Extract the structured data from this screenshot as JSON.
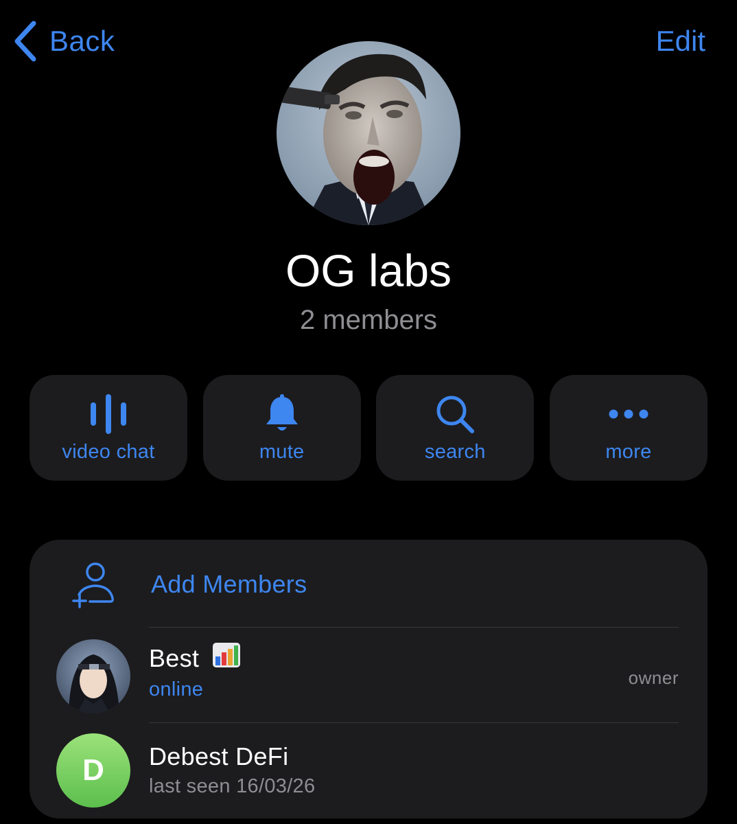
{
  "nav": {
    "back_label": "Back",
    "edit_label": "Edit",
    "accent_color": "#3e86f0"
  },
  "group": {
    "title": "OG labs",
    "subtitle": "2 members",
    "avatar": "group-photo-man-screaming"
  },
  "actions": [
    {
      "label": "video chat",
      "icon": "voice-wave-icon"
    },
    {
      "label": "mute",
      "icon": "bell-icon"
    },
    {
      "label": "search",
      "icon": "magnifier-icon"
    },
    {
      "label": "more",
      "icon": "ellipsis-icon"
    }
  ],
  "members_section": {
    "add_label": "Add Members",
    "add_icon": "add-person-icon",
    "members": [
      {
        "name": "Best",
        "emoji": "bar-chart-emoji",
        "status": "online",
        "status_color": "#3e86f0",
        "role": "owner",
        "avatar": "anime-character-avatar"
      },
      {
        "name": "Debest DeFi",
        "status": "last seen 16/03/26",
        "status_color": "#8e8e93",
        "role": "",
        "avatar_letter": "D",
        "avatar_color": "#7ed267"
      }
    ]
  }
}
